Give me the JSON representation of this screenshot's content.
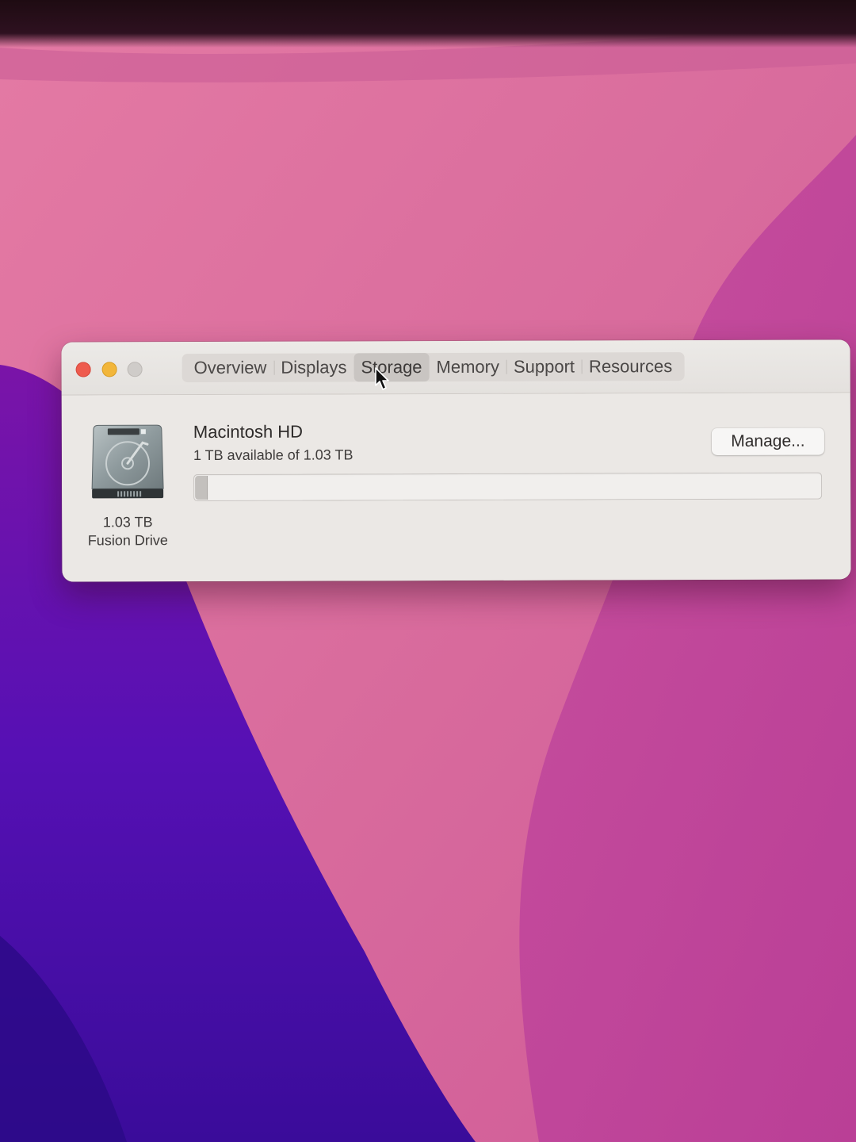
{
  "window": {
    "tabs": [
      {
        "label": "Overview"
      },
      {
        "label": "Displays"
      },
      {
        "label": "Storage",
        "active": true
      },
      {
        "label": "Memory"
      },
      {
        "label": "Support"
      },
      {
        "label": "Resources"
      }
    ]
  },
  "storage": {
    "drive_size": "1.03 TB",
    "drive_type": "Fusion Drive",
    "volume_name": "Macintosh HD",
    "availability": "1 TB available of 1.03 TB",
    "used_fraction": 0.02,
    "manage_label": "Manage..."
  },
  "icons": {
    "drive": "hard-drive-icon",
    "cursor": "mouse-pointer-icon"
  },
  "colors": {
    "close": "#ee5b4e",
    "minimize": "#f2b63a",
    "zoom_disabled": "#cfccc9",
    "wallpaper_pink": "#d96a9e",
    "wallpaper_purple": "#5a12b0"
  }
}
